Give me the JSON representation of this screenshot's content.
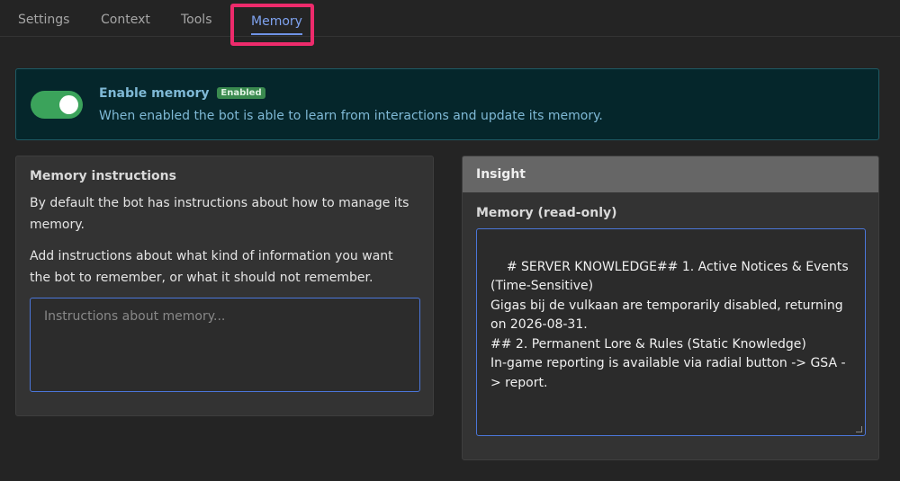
{
  "tabs": [
    {
      "label": "Settings"
    },
    {
      "label": "Context"
    },
    {
      "label": "Tools"
    },
    {
      "label": "Memory",
      "active": true
    }
  ],
  "enable_memory": {
    "title": "Enable memory",
    "badge": "Enabled",
    "description": "When enabled the bot is able to learn from interactions and update its memory.",
    "toggle_on": true
  },
  "memory_instructions": {
    "heading": "Memory instructions",
    "paragraph1": "By default the bot has instructions about how to manage its memory.",
    "paragraph2": "Add instructions about what kind of information you want the bot to remember, or what it should not remember.",
    "input_value": "",
    "input_placeholder": "Instructions about memory..."
  },
  "insight": {
    "header": "Insight",
    "memory_label": "Memory (read-only)",
    "memory_content": "# SERVER KNOWLEDGE## 1. Active Notices & Events (Time-Sensitive)\nGigas bij de vulkaan are temporarily disabled, returning on 2026-08-31.\n## 2. Permanent Lore & Rules (Static Knowledge)\nIn-game reporting is available via radial button -> GSA -> report."
  },
  "colors": {
    "accent": "#7fa3f0",
    "highlight_box": "#ee2b6c",
    "toggle_on": "#3ba35b",
    "info_panel_bg": "#05262b"
  }
}
